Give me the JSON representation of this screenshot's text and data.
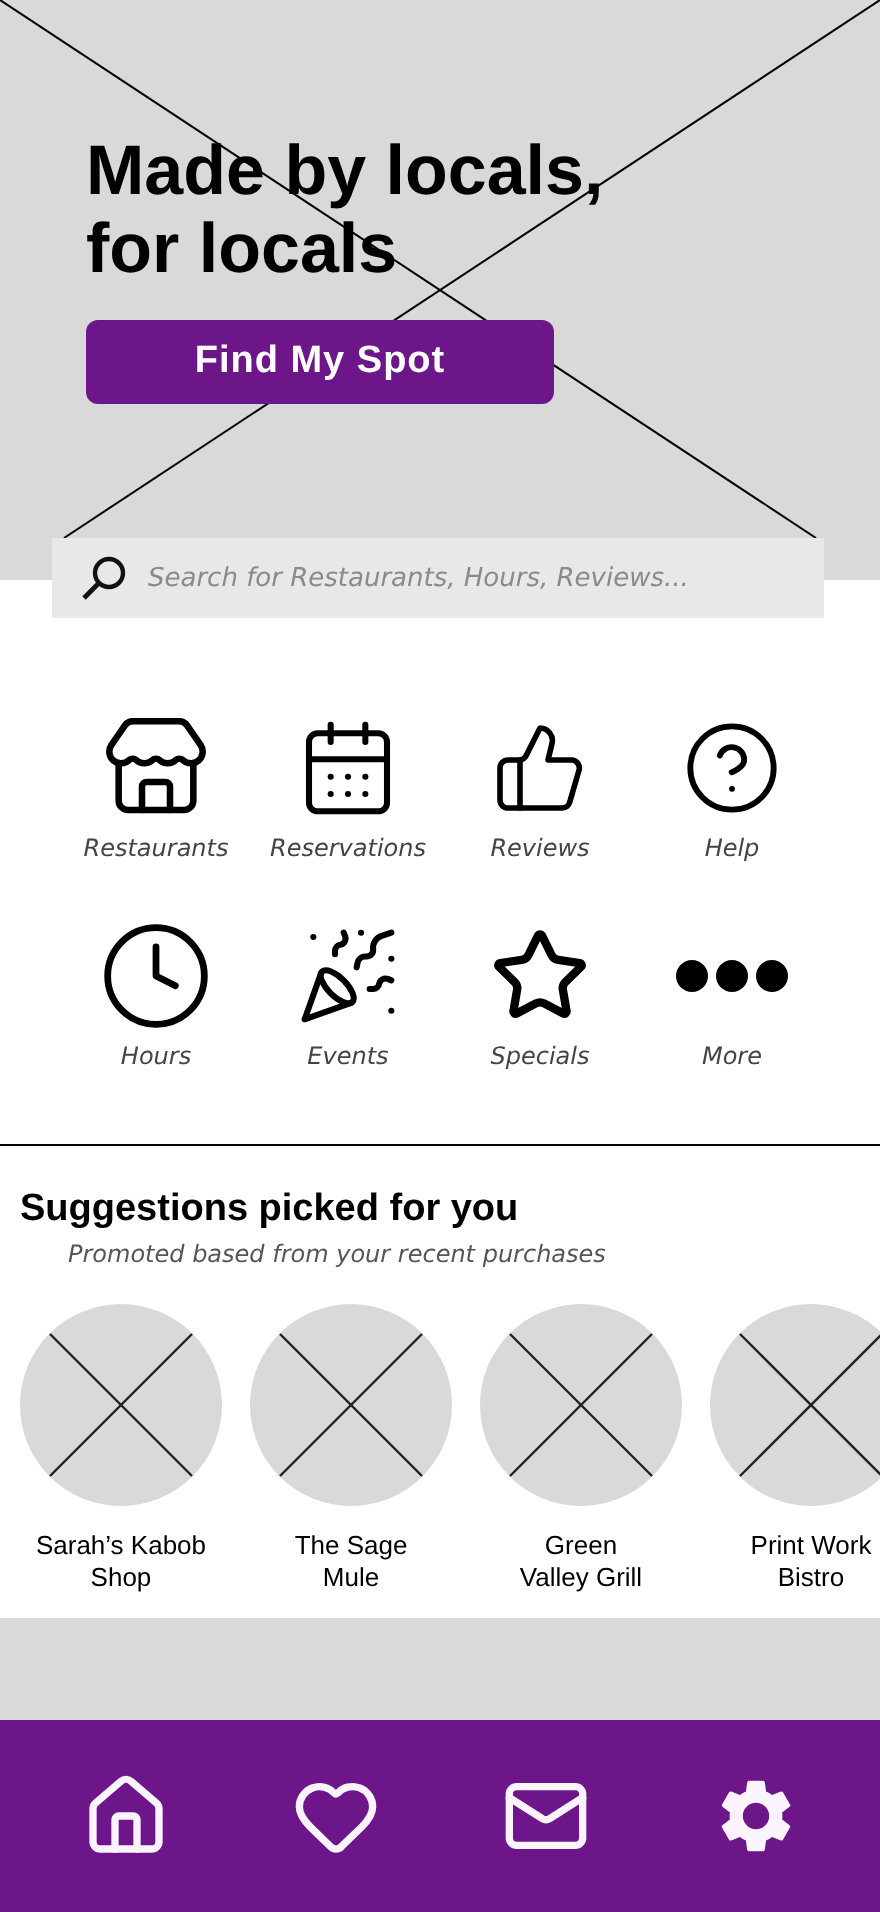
{
  "hero": {
    "title_lines": [
      "Made by locals,",
      "for locals"
    ],
    "button": "Find My Spot"
  },
  "search": {
    "placeholder": "Search for Restaurants, Hours, Reviews..."
  },
  "categories": [
    {
      "kind": "store",
      "label": "Restaurants"
    },
    {
      "kind": "calendar",
      "label": "Reservations"
    },
    {
      "kind": "thumbs",
      "label": "Reviews"
    },
    {
      "kind": "help",
      "label": "Help"
    },
    {
      "kind": "clock",
      "label": "Hours"
    },
    {
      "kind": "party",
      "label": "Events"
    },
    {
      "kind": "star",
      "label": "Specials"
    },
    {
      "kind": "more",
      "label": "More"
    }
  ],
  "suggestions": {
    "title": "Suggestions picked for you",
    "subtitle": "Promoted based from your recent purchases",
    "items": [
      {
        "name_lines": [
          "Sarah’s Kabob",
          "Shop"
        ]
      },
      {
        "name_lines": [
          "The Sage",
          "Mule"
        ]
      },
      {
        "name_lines": [
          "Green",
          "Valley Grill"
        ]
      },
      {
        "name_lines": [
          "Print Work",
          "Bistro"
        ]
      }
    ]
  },
  "nav": [
    {
      "kind": "home"
    },
    {
      "kind": "heart"
    },
    {
      "kind": "mail"
    },
    {
      "kind": "settings"
    }
  ]
}
